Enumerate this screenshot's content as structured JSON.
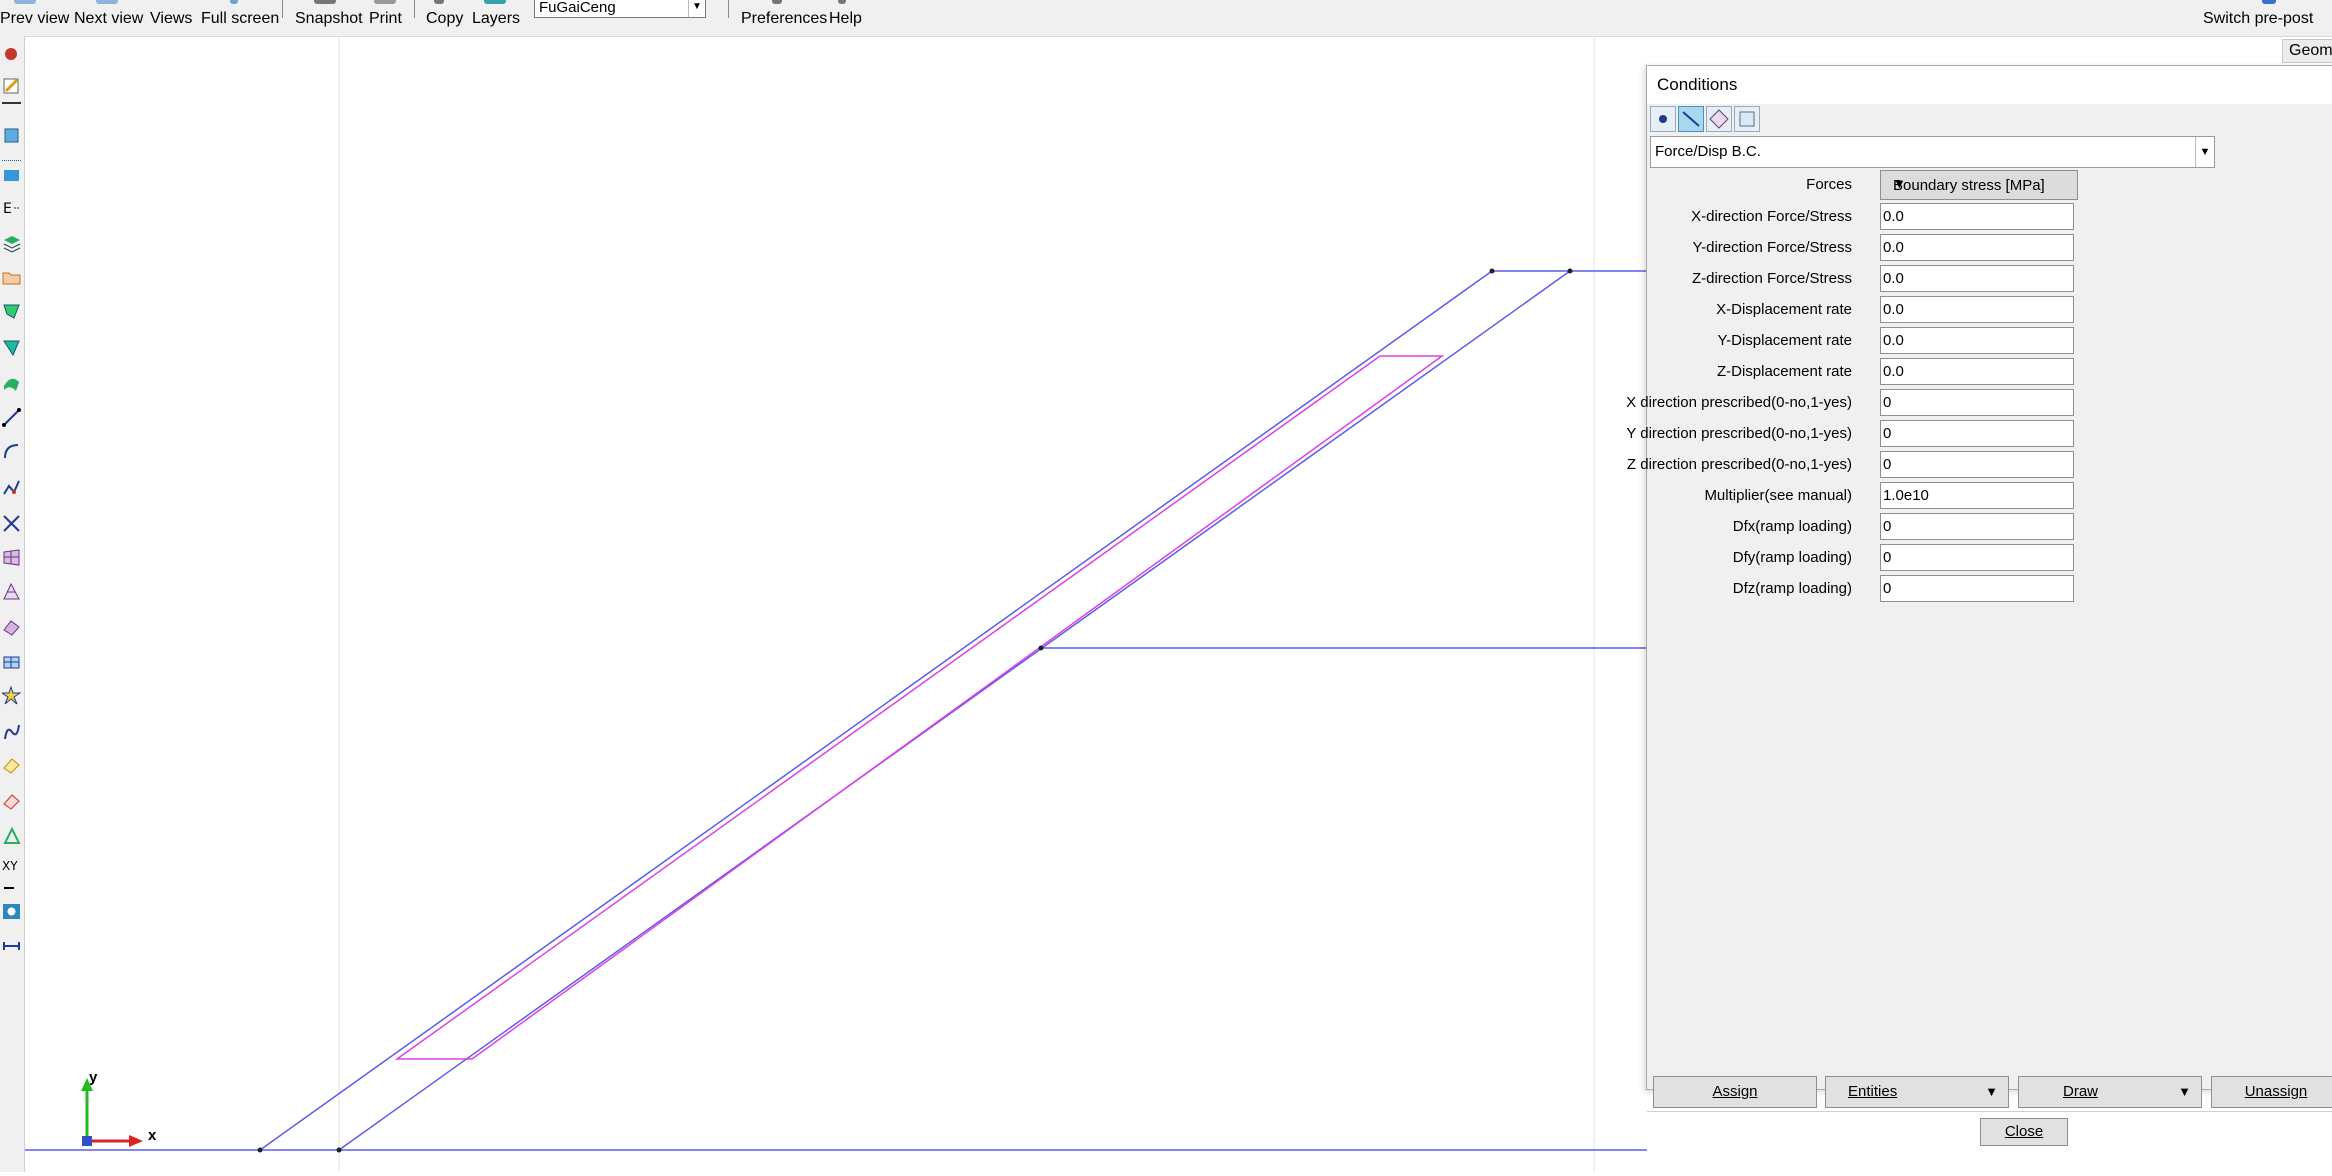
{
  "toolbar": {
    "prev_view": "Prev view",
    "next_view": "Next view",
    "views": "Views",
    "full_screen": "Full screen",
    "snapshot": "Snapshot",
    "print": "Print",
    "copy": "Copy",
    "layers": "Layers",
    "layer_selected": "FuGaiCeng",
    "preferences": "Preferences",
    "help": "Help",
    "switch_prepost": "Switch pre-post",
    "geometry_tab": "Geome"
  },
  "axes": {
    "y": "y",
    "x": "x"
  },
  "dialog": {
    "title": "Conditions",
    "condition_type": "Force/Disp B.C.",
    "forces_label": "Forces",
    "forces_value": "Boundary stress [MPa]",
    "fields": [
      {
        "label": "X-direction Force/Stress",
        "value": "0.0"
      },
      {
        "label": "Y-direction Force/Stress",
        "value": "0.0"
      },
      {
        "label": "Z-direction Force/Stress",
        "value": "0.0"
      },
      {
        "label": "X-Displacement rate",
        "value": "0.0"
      },
      {
        "label": "Y-Displacement rate",
        "value": "0.0"
      },
      {
        "label": "Z-Displacement rate",
        "value": "0.0"
      },
      {
        "label": "X direction prescribed(0-no,1-yes)",
        "value": "0"
      },
      {
        "label": "Y direction prescribed(0-no,1-yes)",
        "value": "0"
      },
      {
        "label": "Z direction prescribed(0-no,1-yes)",
        "value": "0"
      },
      {
        "label": "Multiplier(see manual)",
        "value": "1.0e10"
      },
      {
        "label": "Dfx(ramp loading)",
        "value": "0"
      },
      {
        "label": "Dfy(ramp loading)",
        "value": "0"
      },
      {
        "label": "Dfz(ramp loading)",
        "value": "0"
      }
    ],
    "assign": "Assign",
    "entities": "Entities",
    "draw": "Draw",
    "unassign": "Unassign",
    "close": "Close"
  },
  "colors": {
    "geometry_line": "#5b5bf0",
    "layer_line": "#e040e0",
    "axis_y": "#22bb22",
    "axis_x": "#dd2222"
  }
}
